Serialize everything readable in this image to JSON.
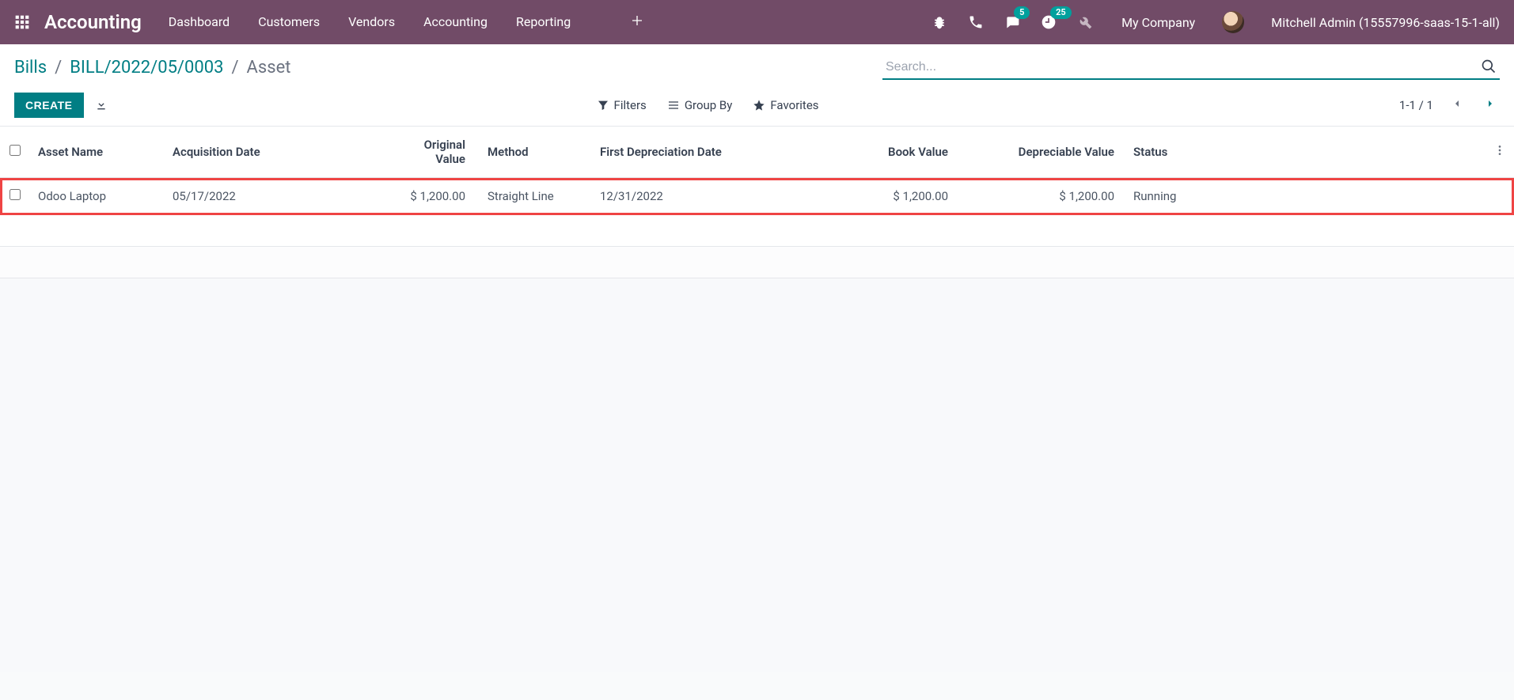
{
  "navbar": {
    "brand": "Accounting",
    "menu": [
      "Dashboard",
      "Customers",
      "Vendors",
      "Accounting",
      "Reporting"
    ],
    "badges": {
      "messages": "5",
      "activities": "25"
    },
    "company": "My Company",
    "username": "Mitchell Admin (15557996-saas-15-1-all)"
  },
  "breadcrumb": {
    "items": [
      "Bills",
      "BILL/2022/05/0003"
    ],
    "current": "Asset",
    "sep": "/"
  },
  "search": {
    "placeholder": "Search..."
  },
  "actions": {
    "create": "CREATE"
  },
  "filters": {
    "filters": "Filters",
    "groupby": "Group By",
    "favorites": "Favorites"
  },
  "pager": {
    "label": "1-1 / 1"
  },
  "table": {
    "headers": {
      "asset_name": "Asset Name",
      "acq_date": "Acquisition Date",
      "orig_value": "Original Value",
      "method": "Method",
      "first_dep": "First Depreciation Date",
      "book_value": "Book Value",
      "dep_value": "Depreciable Value",
      "status": "Status"
    },
    "rows": [
      {
        "asset_name": "Odoo Laptop",
        "acq_date": "05/17/2022",
        "orig_value": "$ 1,200.00",
        "method": "Straight Line",
        "first_dep": "12/31/2022",
        "book_value": "$ 1,200.00",
        "dep_value": "$ 1,200.00",
        "status": "Running"
      }
    ]
  }
}
